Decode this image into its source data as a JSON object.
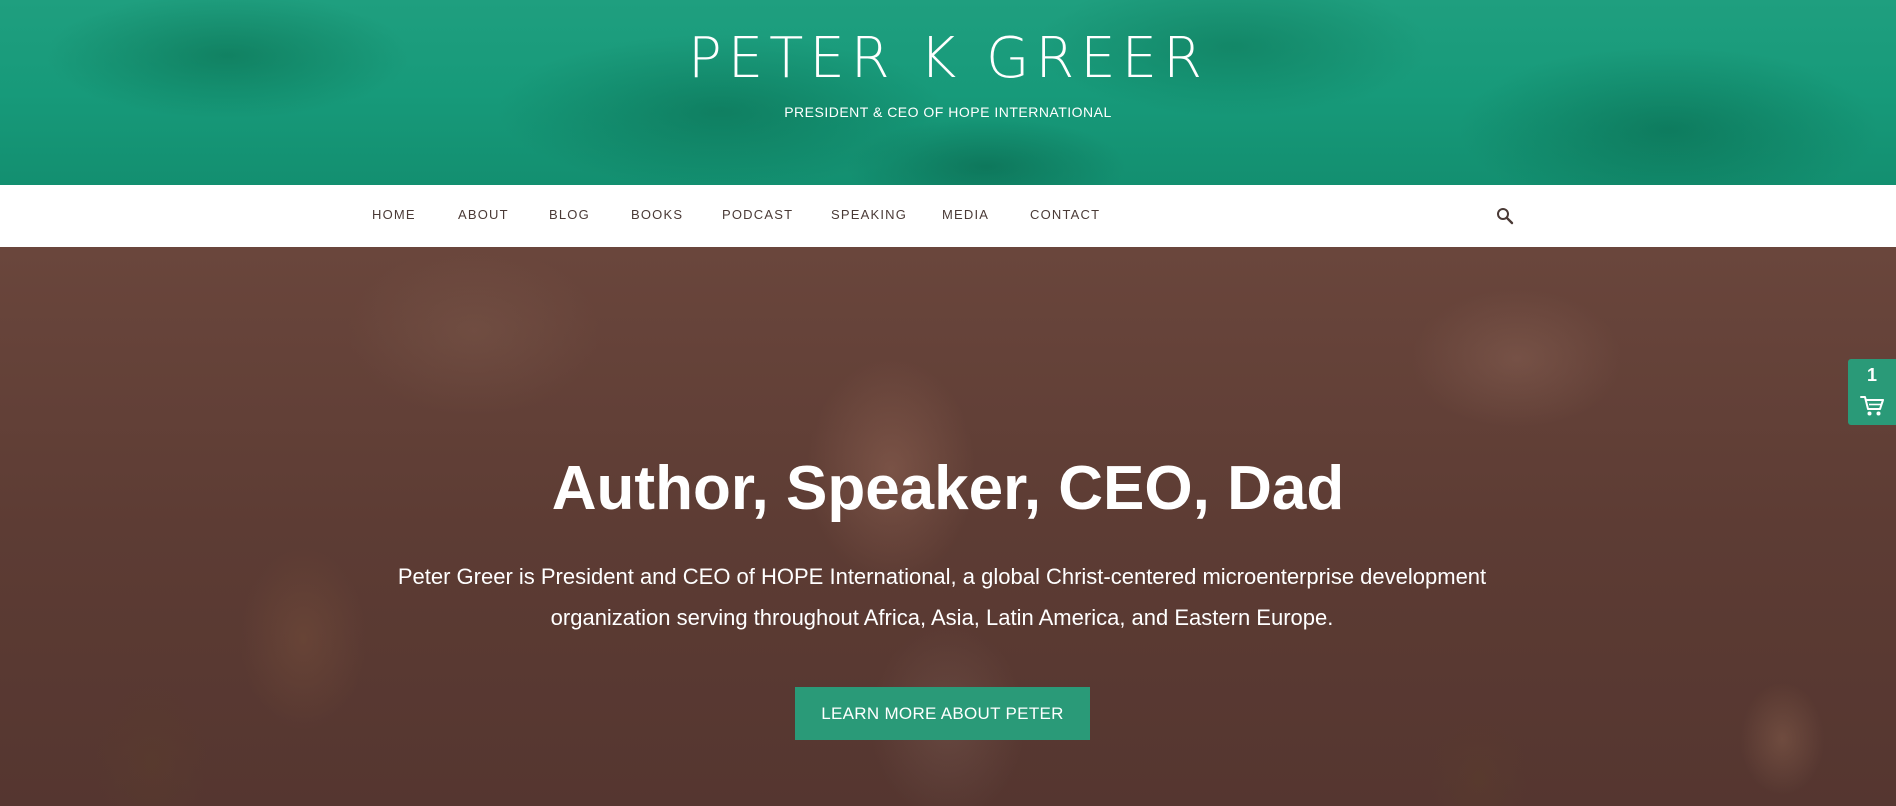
{
  "header": {
    "site_title": "PETER K GREER",
    "tagline": "PRESIDENT & CEO OF HOPE INTERNATIONAL"
  },
  "nav": {
    "items": [
      {
        "label": "HOME"
      },
      {
        "label": "ABOUT"
      },
      {
        "label": "BLOG"
      },
      {
        "label": "BOOKS"
      },
      {
        "label": "PODCAST"
      },
      {
        "label": "SPEAKING"
      },
      {
        "label": "MEDIA"
      },
      {
        "label": "CONTACT"
      }
    ],
    "search_icon": "search-icon"
  },
  "hero": {
    "title": "Author, Speaker, CEO, Dad",
    "description": "Peter Greer is President and CEO of HOPE International, a global Christ-centered microenterprise development organization serving throughout Africa, Asia, Latin America, and Eastern Europe.",
    "cta_label": "LEARN MORE ABOUT PETER"
  },
  "cart": {
    "count": "1",
    "icon": "cart-icon"
  },
  "colors": {
    "brand_green": "#1f9f7f",
    "button_green": "#2a9a78",
    "hero_overlay": "#5d3c34",
    "nav_text": "#4a3a36"
  }
}
